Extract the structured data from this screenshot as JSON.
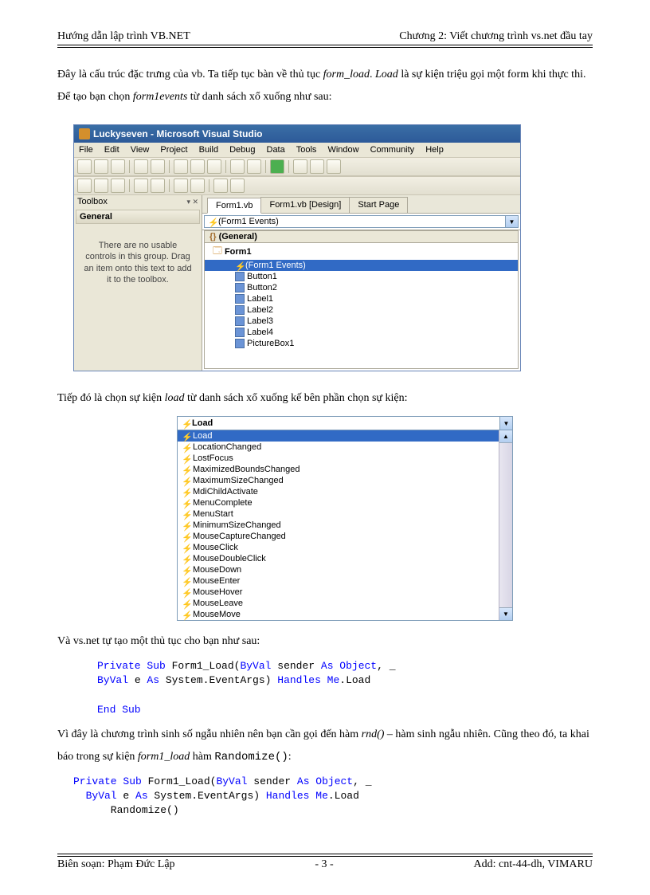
{
  "header": {
    "left": "Hướng dẫn lập trình VB.NET",
    "right": "Chương 2: Viết chương trình vs.net đầu tay"
  },
  "footer": {
    "left": "Biên soạn: Phạm Đức Lập",
    "center": "- 3 -",
    "right": "Add: cnt-44-dh, VIMARU"
  },
  "para1_a": "Đây là cấu trúc đặc trưng của vb. Ta tiếp tục bàn về thủ tục ",
  "para1_i1": "form_load",
  "para1_b": ". ",
  "para1_i2": "Load",
  "para1_c": " là sự kiện triệu gọi một form khi thực thi. Để tạo bạn chọn ",
  "para1_i3": "form1events",
  "para1_d": " từ danh sách xổ xuống như sau:",
  "vs": {
    "title": "Luckyseven - Microsoft Visual Studio",
    "menus": [
      "File",
      "Edit",
      "View",
      "Project",
      "Build",
      "Debug",
      "Data",
      "Tools",
      "Window",
      "Community",
      "Help"
    ],
    "toolbox_title": "Toolbox",
    "general": "General",
    "toolbox_msg": "There are no usable controls in this group. Drag an item onto this text to add it to the toolbox.",
    "tabs": [
      "Form1.vb",
      "Form1.vb [Design]",
      "Start Page"
    ],
    "combo_value": "(Form1 Events)",
    "tree_general": "(General)",
    "tree_form": "Form1",
    "tree_selected": "(Form1 Events)",
    "tree_items": [
      "Button1",
      "Button2",
      "Label1",
      "Label2",
      "Label3",
      "Label4",
      "PictureBox1"
    ]
  },
  "para2_a": "Tiếp đó là chọn sự kiện ",
  "para2_i1": "load",
  "para2_b": " từ danh sách xổ xuống kế bên phần chọn sự kiện:",
  "dropdown": {
    "header": "Load",
    "selected": "Load",
    "items": [
      "LocationChanged",
      "LostFocus",
      "MaximizedBoundsChanged",
      "MaximumSizeChanged",
      "MdiChildActivate",
      "MenuComplete",
      "MenuStart",
      "MinimumSizeChanged",
      "MouseCaptureChanged",
      "MouseClick",
      "MouseDoubleClick",
      "MouseDown",
      "MouseEnter",
      "MouseHover",
      "MouseLeave",
      "MouseMove"
    ]
  },
  "para3": "Và vs.net tự tạo một thủ tục cho bạn như sau:",
  "code1": {
    "l1a": "Private Sub",
    "l1b": " Form1_Load(",
    "l1c": "ByVal",
    "l1d": " sender ",
    "l1e": "As Object",
    "l1f": ", _",
    "l2a": "ByVal",
    "l2b": " e ",
    "l2c": "As",
    "l2d": " System.EventArgs) ",
    "l2e": "Handles Me",
    "l2f": ".Load",
    "l3": "End Sub"
  },
  "para4_a": "Vì đây là chương trình sinh số ngẫu nhiên nên bạn cần gọi đến hàm ",
  "para4_i1": "rnd()",
  "para4_b": " – hàm sinh ngẫu nhiên. Cũng theo đó, ta khai báo trong sự kiện ",
  "para4_i2": "form1_load",
  "para4_c": " hàm ",
  "para4_code": "Randomize()",
  "para4_d": ":",
  "code2": {
    "l1a": "Private Sub",
    "l1b": " Form1_Load(",
    "l1c": "ByVal",
    "l1d": " sender ",
    "l1e": "As Object",
    "l1f": ", _",
    "l2a": "  ByVal",
    "l2b": " e ",
    "l2c": "As",
    "l2d": " System.EventArgs) ",
    "l2e": "Handles Me",
    "l2f": ".Load",
    "l3": "      Randomize()"
  }
}
